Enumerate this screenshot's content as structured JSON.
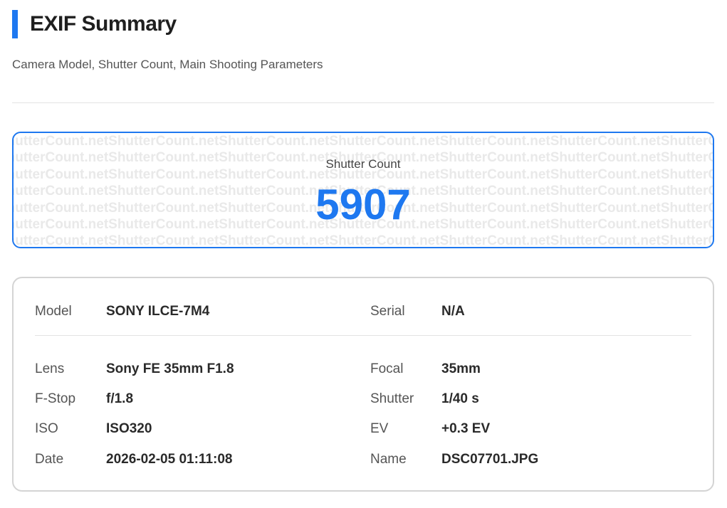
{
  "header": {
    "title": "EXIF Summary",
    "subtitle": "Camera Model, Shutter Count, Main Shooting Parameters",
    "accent_color": "#1e78f0"
  },
  "shutter": {
    "label": "Shutter Count",
    "value": "5907",
    "watermark_text": "ShutterCount.net",
    "accent_color": "#1e78f0"
  },
  "summary": {
    "model": {
      "label": "Model",
      "value": "SONY ILCE-7M4"
    },
    "serial": {
      "label": "Serial",
      "value": "N/A"
    },
    "lens": {
      "label": "Lens",
      "value": "Sony FE 35mm F1.8"
    },
    "focal": {
      "label": "Focal",
      "value": "35mm"
    },
    "fstop": {
      "label": "F-Stop",
      "value": "f/1.8"
    },
    "shutter": {
      "label": "Shutter",
      "value": "1/40 s"
    },
    "iso": {
      "label": "ISO",
      "value": "ISO320"
    },
    "ev": {
      "label": "EV",
      "value": "+0.3 EV"
    },
    "date": {
      "label": "Date",
      "value": "2026-02-05 01:11:08"
    },
    "name": {
      "label": "Name",
      "value": "DSC07701.JPG"
    }
  }
}
